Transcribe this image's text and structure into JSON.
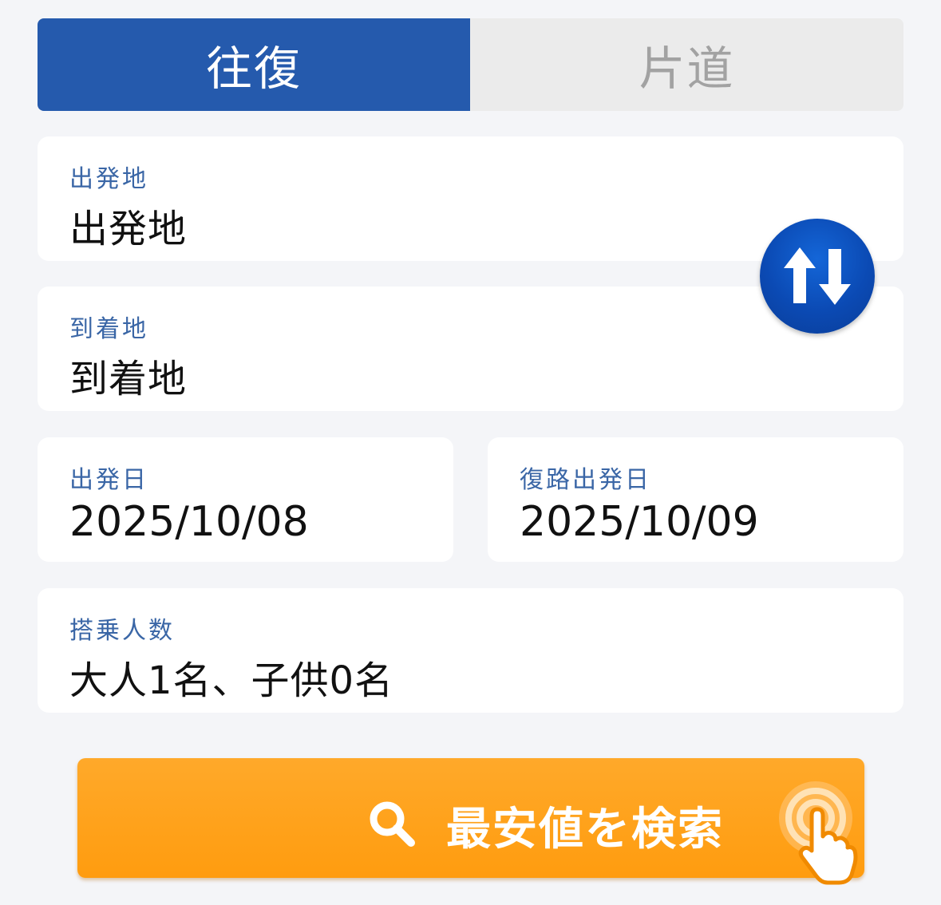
{
  "trip_tabs": {
    "round_trip": "往復",
    "one_way": "片道",
    "selected": "round_trip"
  },
  "fields": {
    "departure": {
      "label": "出発地",
      "value": "出発地"
    },
    "arrival": {
      "label": "到着地",
      "value": "到着地"
    },
    "departure_date": {
      "label": "出発日",
      "value": "2025/10/08"
    },
    "return_date": {
      "label": "復路出発日",
      "value": "2025/10/09"
    },
    "passengers": {
      "label": "搭乗人数",
      "value": "大人1名、子供0名"
    }
  },
  "swap_button": {
    "icon": "swap-vertical-icon"
  },
  "search_button": {
    "label": "最安値を検索",
    "icon": "search-icon",
    "tap_icon": "tap-hand-icon"
  },
  "colors": {
    "tab_active": "#255aad",
    "tab_inactive": "#ebebeb",
    "label": "#3a66a6",
    "search_button": "#ff9f16",
    "swap_button": "#0b4ab4",
    "background": "#f4f5f8"
  }
}
